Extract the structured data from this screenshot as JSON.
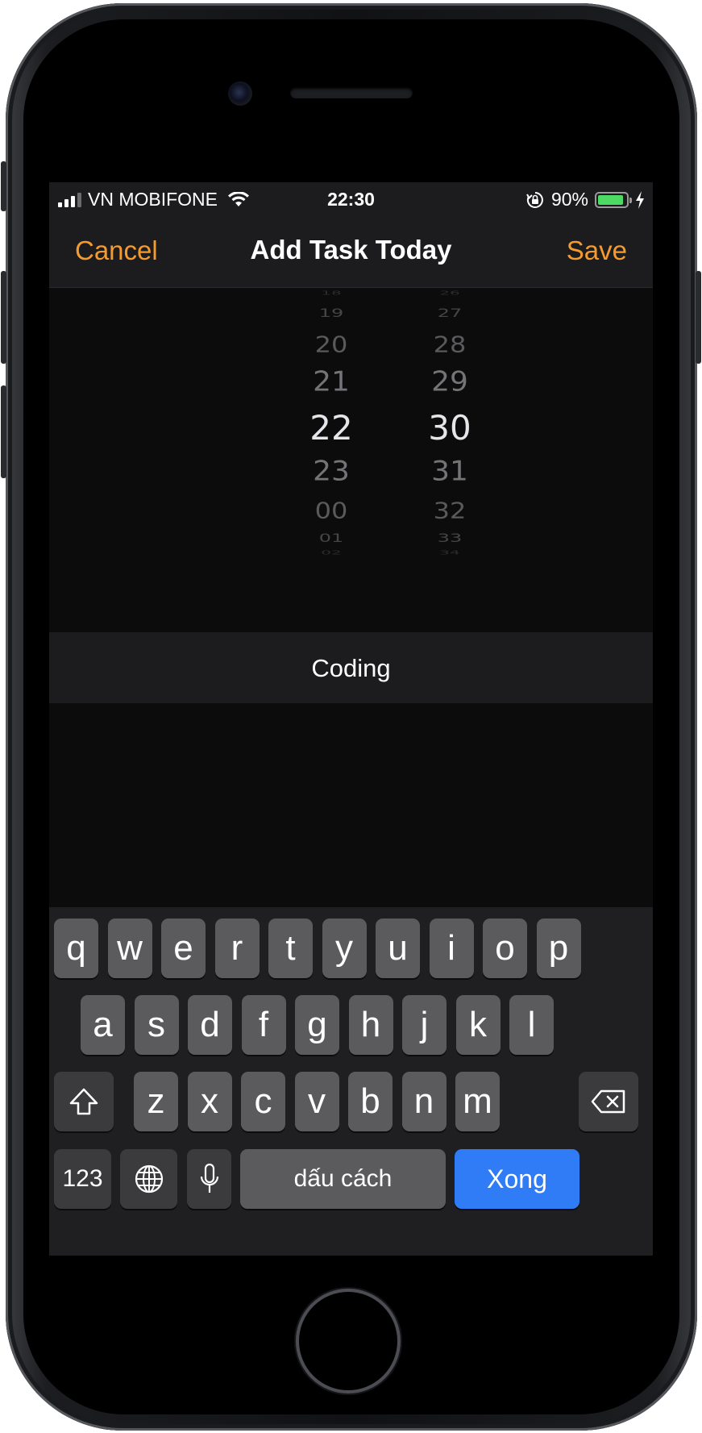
{
  "status_bar": {
    "carrier": "VN MOBIFONE",
    "time": "22:30",
    "battery_percent": "90%",
    "battery_level": 0.9,
    "signal_bars": 4,
    "signal_active": 3,
    "icons": [
      "signal-icon",
      "wifi-icon",
      "orientation-lock-icon",
      "battery-icon",
      "charging-icon"
    ]
  },
  "nav": {
    "cancel": "Cancel",
    "title": "Add Task Today",
    "save": "Save",
    "accent_color": "#f49b2f"
  },
  "picker": {
    "hours": [
      "18",
      "19",
      "20",
      "21",
      "22",
      "23",
      "00",
      "01",
      "02"
    ],
    "minutes": [
      "26",
      "27",
      "28",
      "29",
      "30",
      "31",
      "32",
      "33",
      "34"
    ],
    "selected_hour": "22",
    "selected_minute": "30"
  },
  "task": {
    "value": "Coding"
  },
  "keyboard": {
    "row1": [
      "q",
      "w",
      "e",
      "r",
      "t",
      "y",
      "u",
      "i",
      "o",
      "p"
    ],
    "row2": [
      "a",
      "s",
      "d",
      "f",
      "g",
      "h",
      "j",
      "k",
      "l"
    ],
    "row3": [
      "z",
      "x",
      "c",
      "v",
      "b",
      "n",
      "m"
    ],
    "numbers_key": "123",
    "space_key": "dấu cách",
    "done_key": "Xong",
    "done_color": "#2f7cf6"
  }
}
